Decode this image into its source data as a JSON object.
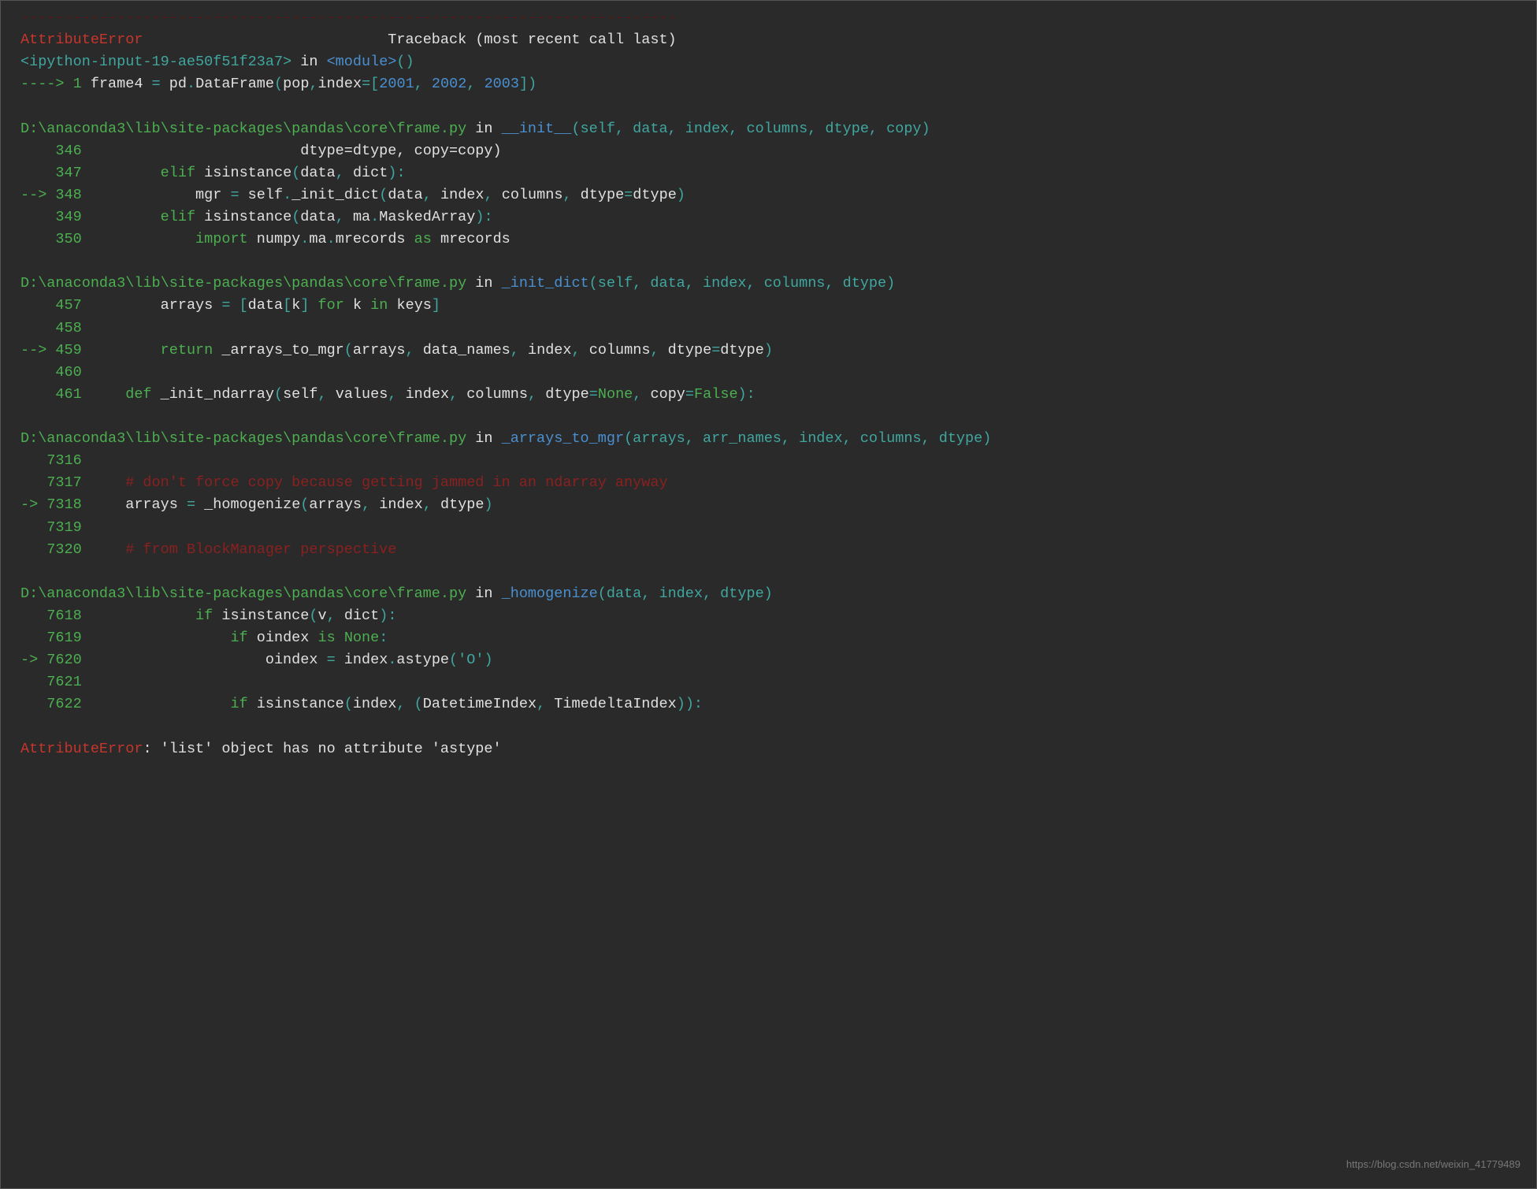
{
  "header": {
    "separator": "---------------------------------------------------------------------------",
    "error_name": "AttributeError",
    "spacing": "                            ",
    "traceback_label": "Traceback (most recent call last)"
  },
  "frame0": {
    "file": "<ipython-input-19-ae50f51f23a7>",
    "in": " in ",
    "func": "<module>",
    "args": "()",
    "arrow": "----> 1 ",
    "code_var": "frame4 ",
    "code_eq": "= ",
    "code_call": "pd",
    "code_dot1": ".",
    "code_df": "DataFrame",
    "code_paren": "(",
    "code_arg1": "pop",
    "code_comma1": ",",
    "code_kw": "index",
    "code_eq2": "=[",
    "code_n1": "2001",
    "code_c2": ", ",
    "code_n2": "2002",
    "code_c3": ", ",
    "code_n3": "2003",
    "code_close": "])"
  },
  "frame1": {
    "file": "D:\\anaconda3\\lib\\site-packages\\pandas\\core\\frame.py",
    "in": " in ",
    "func": "__init__",
    "args": "(self, data, index, columns, dtype, copy)",
    "l346": {
      "num": "    346",
      "code": "                         dtype=dtype, copy=copy)"
    },
    "l347": {
      "num": "    347",
      "elif": "         elif ",
      "isinst": "isinstance",
      "p1": "(",
      "d": "data",
      "c": ", ",
      "dict": "dict",
      "p2": "):"
    },
    "l348": {
      "arrow": "--> 348",
      "pre": "             mgr ",
      "eq": "= ",
      "self": "self",
      "dot": ".",
      "fn": "_init_dict",
      "p1": "(",
      "a": "data",
      "c1": ", ",
      "b": "index",
      "c2": ", ",
      "cc": "columns",
      "c3": ", ",
      "kw": "dtype",
      "eq2": "=",
      "v": "dtype",
      "p2": ")"
    },
    "l349": {
      "num": "    349",
      "elif": "         elif ",
      "isinst": "isinstance",
      "p1": "(",
      "d": "data",
      "c": ", ",
      "ma": "ma",
      "dot": ".",
      "ma2": "MaskedArray",
      "p2": "):"
    },
    "l350": {
      "num": "    350",
      "imp": "             import ",
      "np": "numpy",
      "d1": ".",
      "ma": "ma",
      "d2": ".",
      "mr": "mrecords",
      "as": " as ",
      "mr2": "mrecords"
    }
  },
  "frame2": {
    "file": "D:\\anaconda3\\lib\\site-packages\\pandas\\core\\frame.py",
    "in": " in ",
    "func": "_init_dict",
    "args": "(self, data, index, columns, dtype)",
    "l457": {
      "num": "    457",
      "pre": "         arrays ",
      "eq": "= [",
      "d": "data",
      "br1": "[",
      "k": "k",
      "br2": "] ",
      "for": "for ",
      "kk": "k",
      "in": " in ",
      "keys": "keys",
      "cl": "]"
    },
    "l458": {
      "num": "    458"
    },
    "l459": {
      "arrow": "--> 459",
      "ret": "         return ",
      "fn": "_arrays_to_mgr",
      "p1": "(",
      "a1": "arrays",
      "c1": ", ",
      "a2": "data_names",
      "c2": ", ",
      "a3": "index",
      "c3": ", ",
      "a4": "columns",
      "c4": ", ",
      "kw": "dtype",
      "eq": "=",
      "v": "dtype",
      "p2": ")"
    },
    "l460": {
      "num": "    460"
    },
    "l461": {
      "num": "    461",
      "def": "     def ",
      "fn": "_init_ndarray",
      "p1": "(",
      "s": "self",
      "c1": ", ",
      "v": "values",
      "c2": ", ",
      "i": "index",
      "c3": ", ",
      "col": "columns",
      "c4": ", ",
      "dt": "dtype",
      "eq1": "=",
      "none": "None",
      "c5": ", ",
      "cp": "copy",
      "eq2": "=",
      "false": "False",
      "p2": "):"
    }
  },
  "frame3": {
    "file": "D:\\anaconda3\\lib\\site-packages\\pandas\\core\\frame.py",
    "in": " in ",
    "func": "_arrays_to_mgr",
    "args": "(arrays, arr_names, index, columns, dtype)",
    "l7316": {
      "num": "   7316"
    },
    "l7317": {
      "num": "   7317",
      "comment": "     # don't force copy because getting jammed in an ndarray anyway"
    },
    "l7318": {
      "arrow": "-> 7318",
      "pre": "     arrays ",
      "eq": "= ",
      "fn": "_homogenize",
      "p1": "(",
      "a1": "arrays",
      "c1": ", ",
      "a2": "index",
      "c2": ", ",
      "a3": "dtype",
      "p2": ")"
    },
    "l7319": {
      "num": "   7319"
    },
    "l7320": {
      "num": "   7320",
      "comment": "     # from BlockManager perspective"
    }
  },
  "frame4": {
    "file": "D:\\anaconda3\\lib\\site-packages\\pandas\\core\\frame.py",
    "in": " in ",
    "func": "_homogenize",
    "args": "(data, index, dtype)",
    "l7618": {
      "num": "   7618",
      "if": "             if ",
      "isinst": "isinstance",
      "p1": "(",
      "v": "v",
      "c": ", ",
      "dict": "dict",
      "p2": "):"
    },
    "l7619": {
      "num": "   7619",
      "if": "                 if ",
      "oi": "oindex",
      "is": " is ",
      "none": "None",
      "col": ":"
    },
    "l7620": {
      "arrow": "-> 7620",
      "pre": "                     oindex ",
      "eq": "= ",
      "idx": "index",
      "dot": ".",
      "fn": "astype",
      "p1": "(",
      "s": "'O'",
      "p2": ")"
    },
    "l7621": {
      "num": "   7621"
    },
    "l7622": {
      "num": "   7622",
      "if": "                 if ",
      "isinst": "isinstance",
      "p1": "(",
      "idx": "index",
      "c": ", (",
      "dti": "DatetimeIndex",
      "c2": ", ",
      "tdi": "TimedeltaIndex",
      "p2": ")):"
    }
  },
  "footer": {
    "error_name": "AttributeError",
    "message": ": 'list' object has no attribute 'astype'"
  },
  "watermark": "https://blog.csdn.net/weixin_41779489"
}
